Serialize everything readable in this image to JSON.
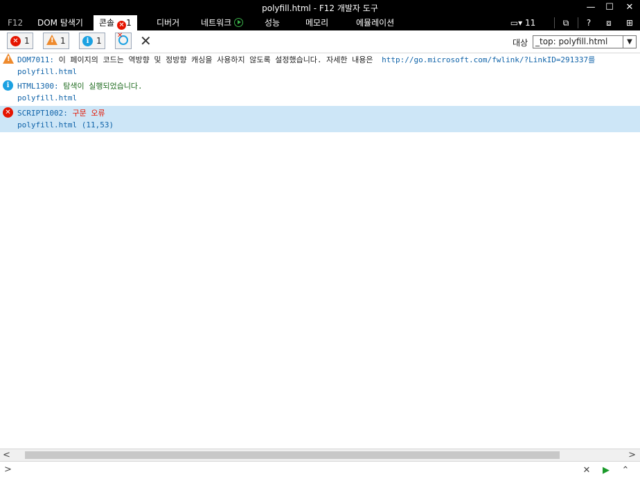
{
  "window": {
    "title": "polyfill.html - F12 개발자 도구",
    "minimize": "—",
    "maximize": "☐",
    "close": "✕"
  },
  "tabs": [
    {
      "label": "F12"
    },
    {
      "label": "DOM 탐색기"
    },
    {
      "label": "콘솔",
      "badge": "1"
    },
    {
      "label": "디버거"
    },
    {
      "label": "네트워크"
    },
    {
      "label": "성능"
    },
    {
      "label": "메모리"
    },
    {
      "label": "에뮬레이션"
    }
  ],
  "right_tools": {
    "emulation_version": "11",
    "help": "?"
  },
  "toolbar": {
    "error_count": "1",
    "warning_count": "1",
    "info_count": "1",
    "target_label": "대상",
    "target_value": "_top: polyfill.html"
  },
  "messages": [
    {
      "level": "warning",
      "code": "DOM7011:",
      "text": "이 페이지의 코드는 역방향 및 정방향 캐싱을 사용하지 않도록 설정했습니다. 자세한 내용은",
      "link": "http://go.microsoft.com/fwlink/?LinkID=291337를",
      "source": "polyfill.html"
    },
    {
      "level": "info",
      "code": "HTML1300:",
      "text": "탐색이 실행되었습니다.",
      "source": "polyfill.html"
    },
    {
      "level": "error",
      "code": "SCRIPT1002:",
      "text": "구문 오류",
      "source": "polyfill.html (11,53)"
    }
  ],
  "colors": {
    "chrome": "#000000",
    "error": "#e51400",
    "warning": "#ee8a2d",
    "info": "#1ba1e2",
    "selected_row": "#cde6f7"
  }
}
